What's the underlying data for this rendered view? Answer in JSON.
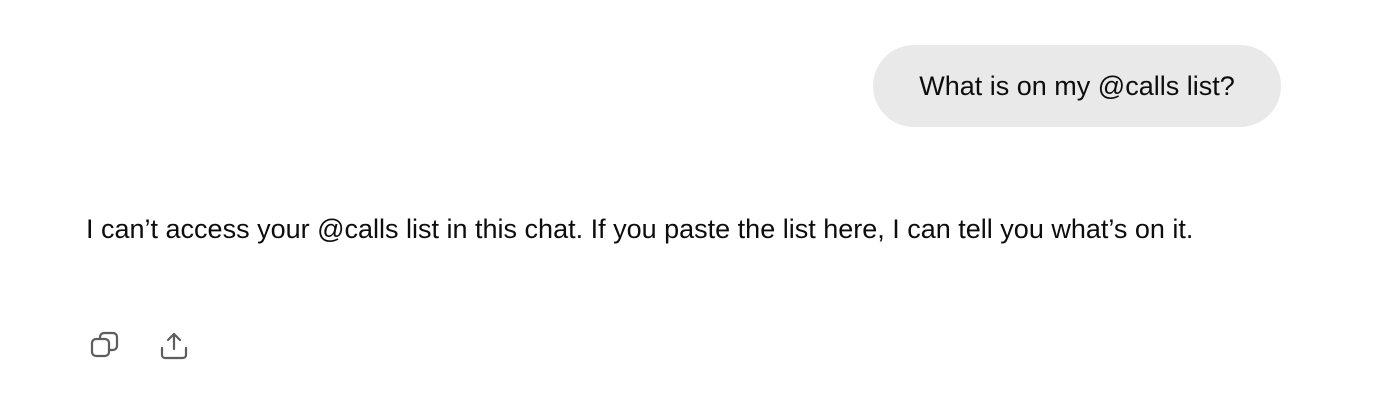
{
  "conversation": {
    "user_message": "What is on my @calls list?",
    "assistant_message": "I can’t access your @calls list in this chat. If you paste the list here, I can tell you what’s on it."
  },
  "actions": {
    "copy_icon": "copy-icon",
    "share_icon": "share-icon"
  },
  "colors": {
    "user_bubble_bg": "#e9e9e9",
    "text": "#0d0d0d",
    "icon": "#5d5d5d"
  }
}
